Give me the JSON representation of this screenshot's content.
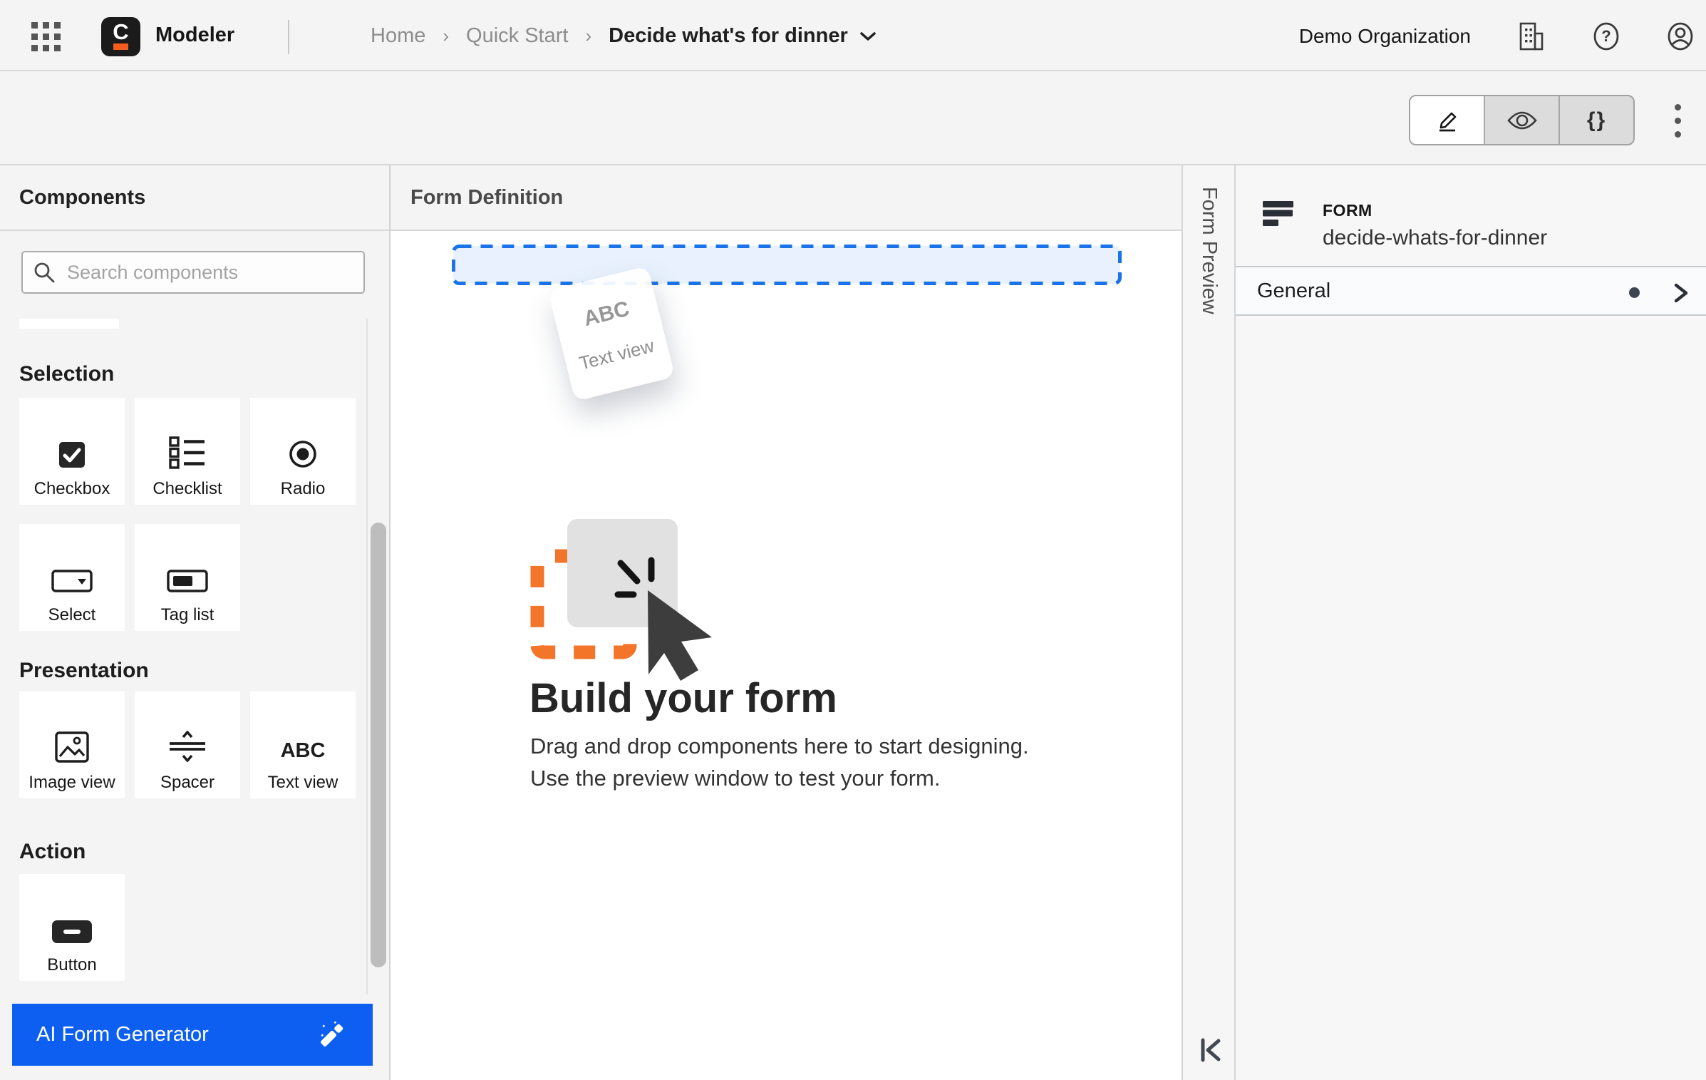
{
  "topbar": {
    "app_name": "Modeler",
    "logo_letter": "C",
    "breadcrumbs": {
      "separator": "›",
      "items": [
        "Home",
        "Quick Start"
      ],
      "current": "Decide what's for dinner"
    },
    "org_name": "Demo Organization"
  },
  "toolbar": {
    "braces_label": "{}"
  },
  "components_panel": {
    "title": "Components",
    "search_placeholder": "Search components",
    "sections": {
      "selection": {
        "label": "Selection",
        "items": [
          {
            "label": "Checkbox",
            "icon": "checkbox-icon"
          },
          {
            "label": "Checklist",
            "icon": "checklist-icon"
          },
          {
            "label": "Radio",
            "icon": "radio-icon"
          },
          {
            "label": "Select",
            "icon": "select-icon"
          },
          {
            "label": "Tag list",
            "icon": "tag-list-icon"
          }
        ]
      },
      "presentation": {
        "label": "Presentation",
        "items": [
          {
            "label": "Image view",
            "icon": "image-view-icon"
          },
          {
            "label": "Spacer",
            "icon": "spacer-icon"
          },
          {
            "label": "Text view",
            "icon": "text-view-icon",
            "icon_text": "ABC"
          }
        ]
      },
      "action": {
        "label": "Action",
        "items": [
          {
            "label": "Button",
            "icon": "button-icon"
          }
        ]
      }
    },
    "ai_button": {
      "label": "AI Form Generator"
    }
  },
  "canvas": {
    "title": "Form Definition",
    "drag_ghost": {
      "icon_text": "ABC",
      "label": "Text view"
    },
    "empty_state": {
      "heading": "Build your form",
      "line1": "Drag and drop components here to start designing.",
      "line2": "Use the preview window to test your form."
    }
  },
  "preview_tab": {
    "label": "Form Preview"
  },
  "properties_panel": {
    "type_label": "FORM",
    "form_id": "decide-whats-for-dinner",
    "general_group": {
      "label": "General"
    }
  },
  "colors": {
    "accent_blue": "#0d5ff2",
    "dropzone_border": "#1a73e8",
    "dropzone_fill": "#e8f1fd",
    "illustration_orange": "#f2752a",
    "logo_orange": "#f55d1c",
    "status_dot": "#3e4450"
  }
}
